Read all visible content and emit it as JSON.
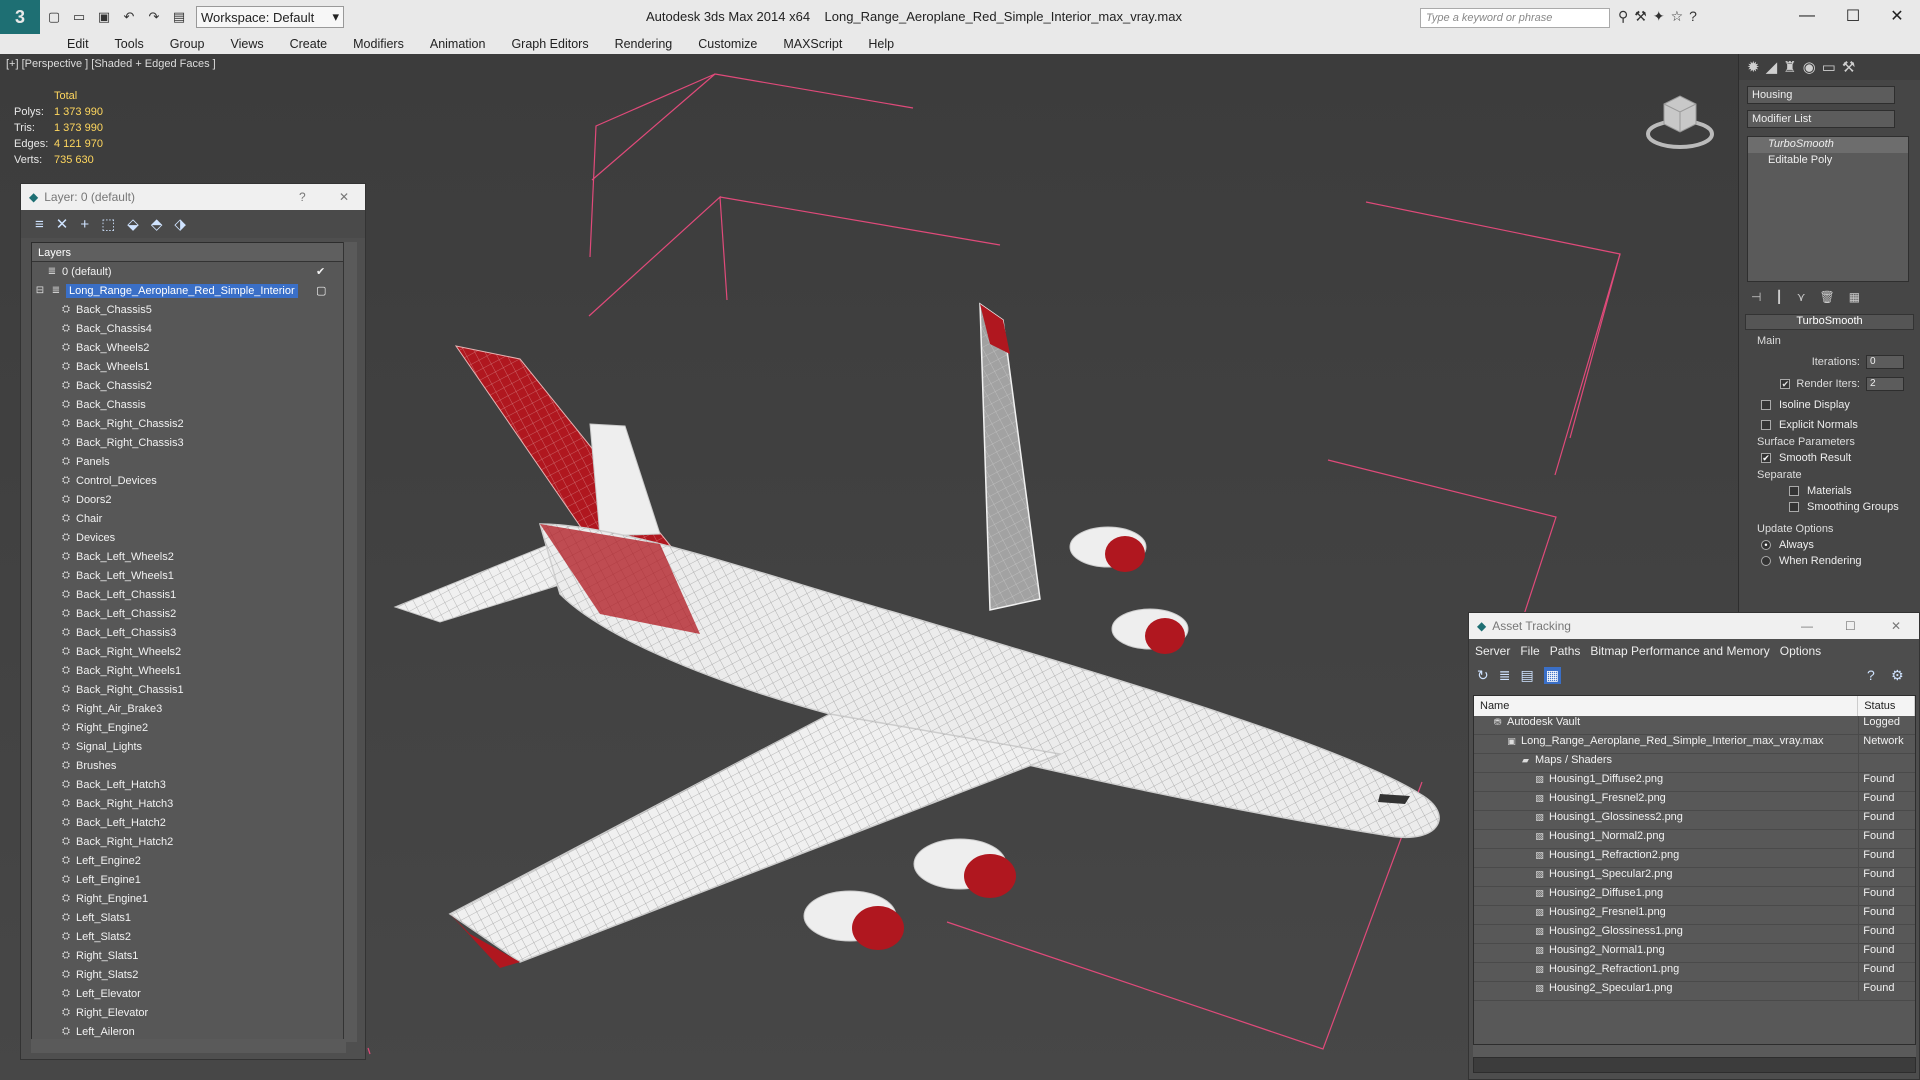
{
  "titlebar": {
    "logo": "3",
    "workspace": "Workspace: Default",
    "app_version": "Autodesk 3ds Max  2014 x64",
    "filename": "Long_Range_Aeroplane_Red_Simple_Interior_max_vray.max",
    "search_placeholder": "Type a keyword or phrase"
  },
  "menu": [
    "Edit",
    "Tools",
    "Group",
    "Views",
    "Create",
    "Modifiers",
    "Animation",
    "Graph Editors",
    "Rendering",
    "Customize",
    "MAXScript",
    "Help"
  ],
  "viewport": {
    "label": "[+] [Perspective ] [Shaded + Edged Faces ]",
    "stats": {
      "header": "Total",
      "rows": [
        {
          "k": "Polys:",
          "v": "1 373 990"
        },
        {
          "k": "Tris:",
          "v": "1 373 990"
        },
        {
          "k": "Edges:",
          "v": "4 121 970"
        },
        {
          "k": "Verts:",
          "v": "735 630"
        }
      ]
    }
  },
  "layer_panel": {
    "title": "Layer: 0 (default)",
    "help": "?",
    "column": "Layers",
    "default_layer": "0 (default)",
    "selected_layer": "Long_Range_Aeroplane_Red_Simple_Interior",
    "items": [
      "Back_Chassis5",
      "Back_Chassis4",
      "Back_Wheels2",
      "Back_Wheels1",
      "Back_Chassis2",
      "Back_Chassis",
      "Back_Right_Chassis2",
      "Back_Right_Chassis3",
      "Panels",
      "Control_Devices",
      "Doors2",
      "Chair",
      "Devices",
      "Back_Left_Wheels2",
      "Back_Left_Wheels1",
      "Back_Left_Chassis1",
      "Back_Left_Chassis2",
      "Back_Left_Chassis3",
      "Back_Right_Wheels2",
      "Back_Right_Wheels1",
      "Back_Right_Chassis1",
      "Right_Air_Brake3",
      "Right_Engine2",
      "Signal_Lights",
      "Brushes",
      "Back_Left_Hatch3",
      "Back_Right_Hatch3",
      "Back_Left_Hatch2",
      "Back_Right_Hatch2",
      "Left_Engine2",
      "Left_Engine1",
      "Right_Engine1",
      "Left_Slats1",
      "Left_Slats2",
      "Right_Slats1",
      "Right_Slats2",
      "Left_Elevator",
      "Right_Elevator",
      "Left_Aileron"
    ]
  },
  "command_panel": {
    "object_name": "Housing",
    "modifier_list": "Modifier List",
    "stack": [
      "TurboSmooth",
      "Editable Poly"
    ],
    "rollout": "TurboSmooth",
    "main_group": "Main",
    "iterations_label": "Iterations:",
    "iterations_value": "0",
    "render_iters_label": "Render Iters:",
    "render_iters_value": "2",
    "isoline": "Isoline Display",
    "explicit": "Explicit Normals",
    "surface_group": "Surface Parameters",
    "smooth_result": "Smooth Result",
    "separate": "Separate",
    "materials": "Materials",
    "smoothing_groups": "Smoothing Groups",
    "update_group": "Update Options",
    "always": "Always",
    "when_rendering": "When Rendering"
  },
  "asset_tracking": {
    "title": "Asset Tracking",
    "menu": [
      "Server",
      "File",
      "Paths",
      "Bitmap Performance and Memory",
      "Options"
    ],
    "col_name": "Name",
    "col_status": "Status",
    "rows": [
      {
        "indent": 1,
        "icon": "vault",
        "name": "Autodesk Vault",
        "status": "Logged"
      },
      {
        "indent": 2,
        "icon": "max",
        "name": "Long_Range_Aeroplane_Red_Simple_Interior_max_vray.max",
        "status": "Network"
      },
      {
        "indent": 3,
        "icon": "maps",
        "name": "Maps / Shaders",
        "status": ""
      },
      {
        "indent": 4,
        "icon": "file",
        "name": "Housing1_Diffuse2.png",
        "status": "Found"
      },
      {
        "indent": 4,
        "icon": "file",
        "name": "Housing1_Fresnel2.png",
        "status": "Found"
      },
      {
        "indent": 4,
        "icon": "file",
        "name": "Housing1_Glossiness2.png",
        "status": "Found"
      },
      {
        "indent": 4,
        "icon": "file",
        "name": "Housing1_Normal2.png",
        "status": "Found"
      },
      {
        "indent": 4,
        "icon": "file",
        "name": "Housing1_Refraction2.png",
        "status": "Found"
      },
      {
        "indent": 4,
        "icon": "file",
        "name": "Housing1_Specular2.png",
        "status": "Found"
      },
      {
        "indent": 4,
        "icon": "file",
        "name": "Housing2_Diffuse1.png",
        "status": "Found"
      },
      {
        "indent": 4,
        "icon": "file",
        "name": "Housing2_Fresnel1.png",
        "status": "Found"
      },
      {
        "indent": 4,
        "icon": "file",
        "name": "Housing2_Glossiness1.png",
        "status": "Found"
      },
      {
        "indent": 4,
        "icon": "file",
        "name": "Housing2_Normal1.png",
        "status": "Found"
      },
      {
        "indent": 4,
        "icon": "file",
        "name": "Housing2_Refraction1.png",
        "status": "Found"
      },
      {
        "indent": 4,
        "icon": "file",
        "name": "Housing2_Specular1.png",
        "status": "Found"
      }
    ]
  },
  "colors": {
    "accent": "#3a6fc7",
    "stat_value": "#ffd75e",
    "bbox": "#e04a7a",
    "fuselage": "#e8e8e8",
    "livery": "#b0171f"
  }
}
